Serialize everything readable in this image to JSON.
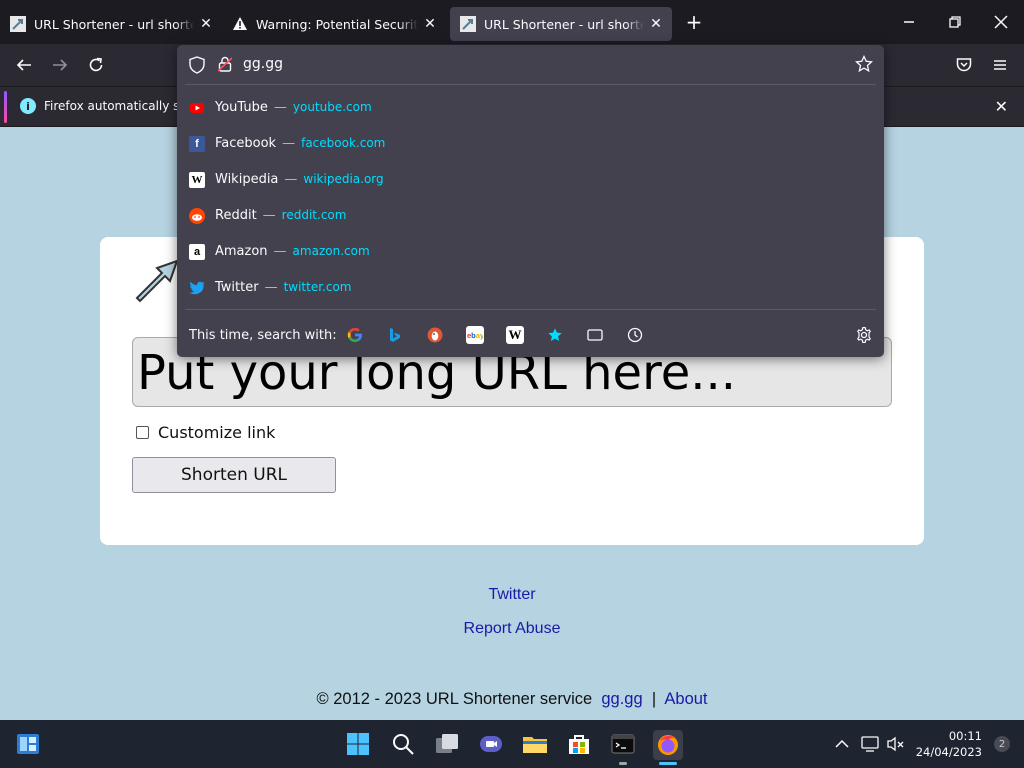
{
  "browser": {
    "tabs": [
      {
        "title": "URL Shortener - url shortening s",
        "active": false
      },
      {
        "title": "Warning: Potential Security Risk",
        "active": false
      },
      {
        "title": "URL Shortener - url shortening s",
        "active": true
      }
    ],
    "new_tab": "+",
    "url_typed": "gg.gg",
    "notification": "Firefox automatically sen"
  },
  "suggestions": [
    {
      "name": "YouTube",
      "url": "youtube.com",
      "icon": "youtube-icon",
      "color": "#ff0000"
    },
    {
      "name": "Facebook",
      "url": "facebook.com",
      "icon": "facebook-icon",
      "color": "#1877f2"
    },
    {
      "name": "Wikipedia",
      "url": "wikipedia.org",
      "icon": "wikipedia-icon",
      "color": "#ffffff"
    },
    {
      "name": "Reddit",
      "url": "reddit.com",
      "icon": "reddit-icon",
      "color": "#ff4500"
    },
    {
      "name": "Amazon",
      "url": "amazon.com",
      "icon": "amazon-icon",
      "color": "#ffffff"
    },
    {
      "name": "Twitter",
      "url": "twitter.com",
      "icon": "twitter-icon",
      "color": "#1da1f2"
    }
  ],
  "separator": "—",
  "search_with_label": "This time, search with:",
  "engines": [
    "google-icon",
    "bing-icon",
    "duckduckgo-icon",
    "ebay-icon",
    "wikipedia-icon",
    "bookmarks-icon",
    "tabs-icon",
    "history-icon"
  ],
  "page": {
    "url_placeholder": "Put your long URL here...",
    "customize_label": "Customize link",
    "shorten_button": "Shorten URL",
    "links": [
      "Twitter",
      "Report Abuse"
    ],
    "footer": {
      "copyright": "© 2012 - 2023 URL Shortener service",
      "domain_link": "gg.gg",
      "separator": "|",
      "about_link": "About"
    },
    "bg_color": "#b5d3e1"
  },
  "taskbar": {
    "time": "00:11",
    "date": "24/04/2023",
    "notifications": "2"
  }
}
